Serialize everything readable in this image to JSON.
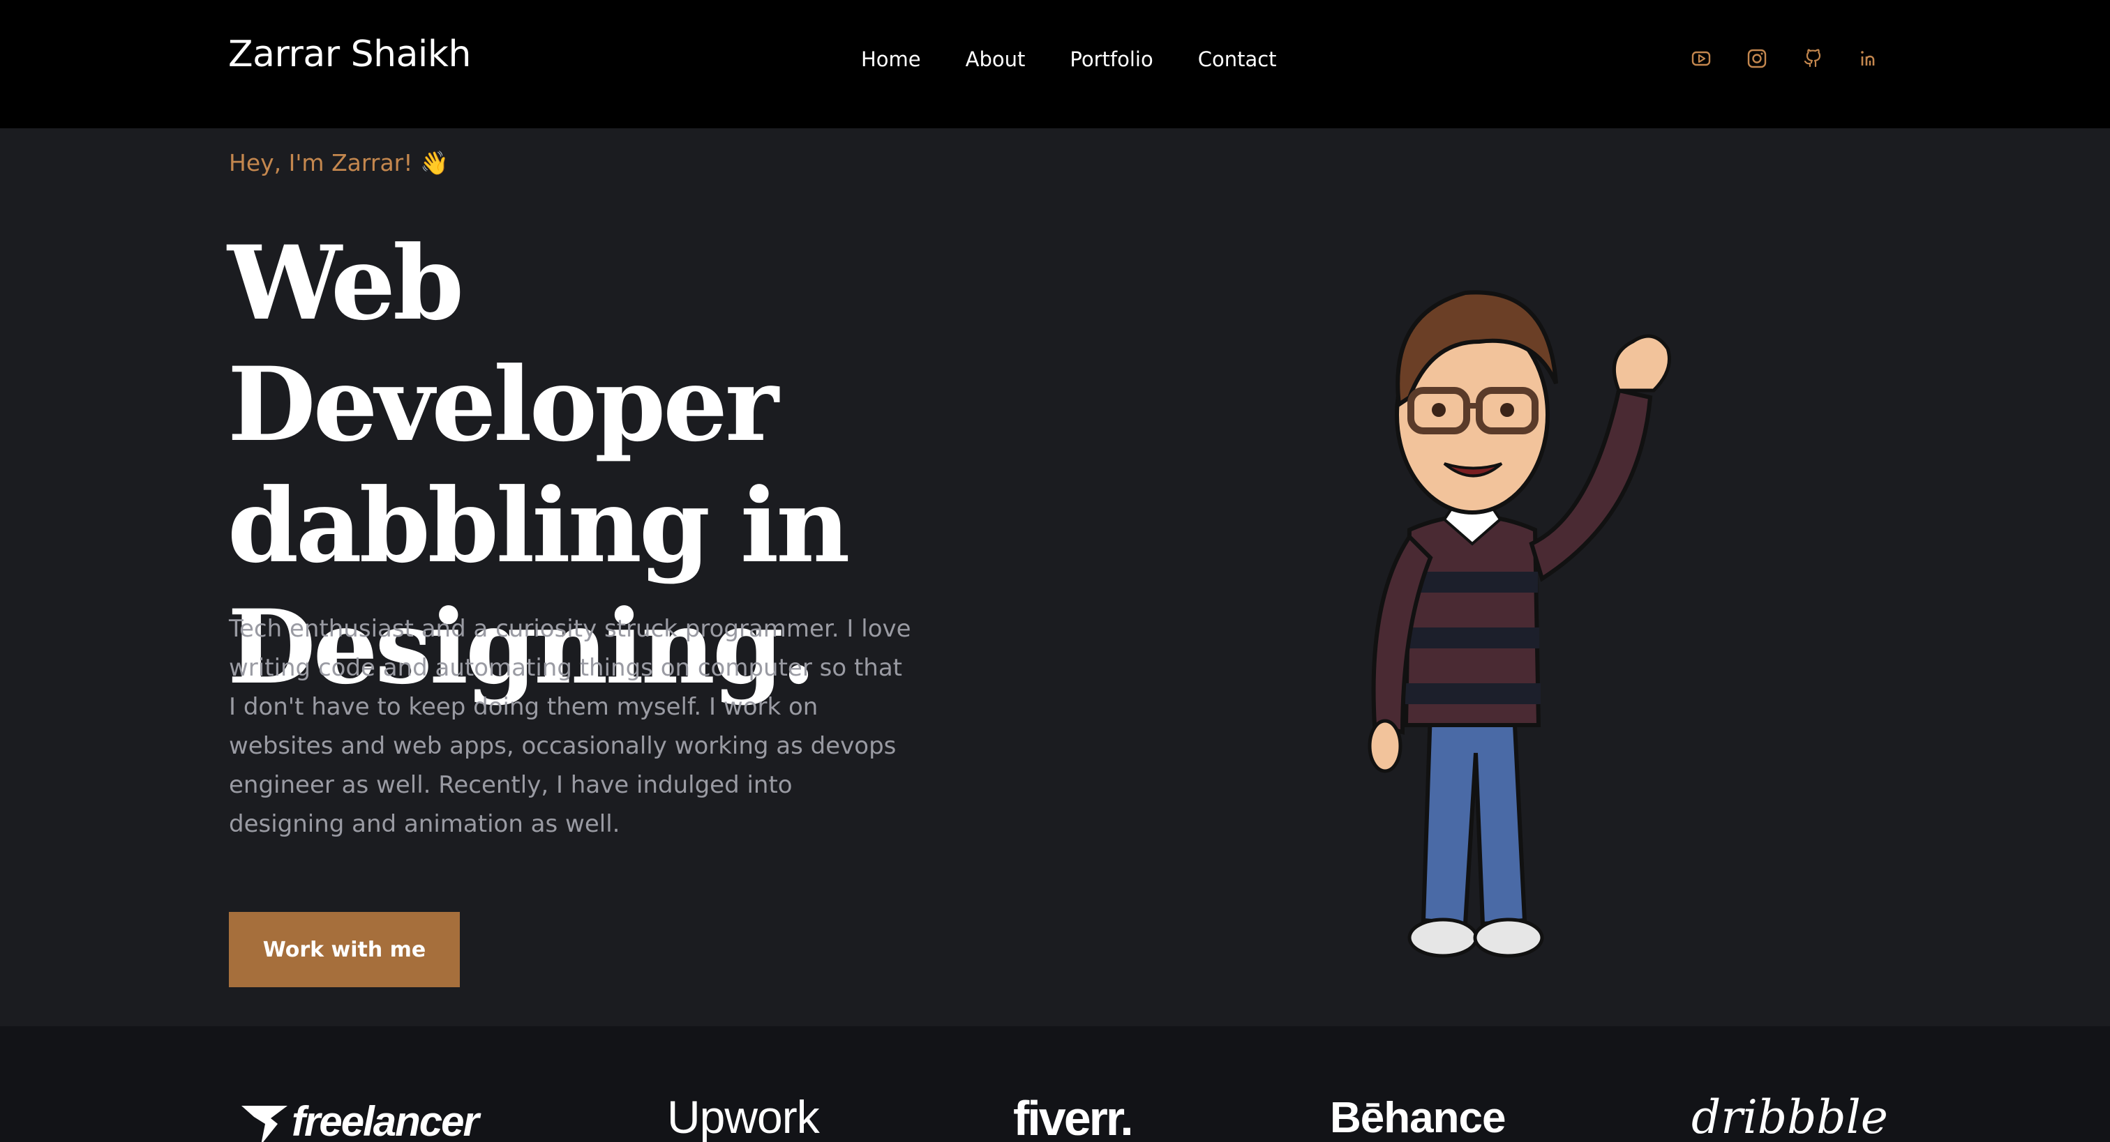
{
  "header": {
    "brand": "Zarrar Shaikh",
    "nav": [
      {
        "label": "Home"
      },
      {
        "label": "About"
      },
      {
        "label": "Portfolio"
      },
      {
        "label": "Contact"
      }
    ],
    "socials": [
      {
        "icon": "youtube-icon"
      },
      {
        "icon": "instagram-icon"
      },
      {
        "icon": "github-icon"
      },
      {
        "icon": "linkedin-icon"
      }
    ],
    "accent_color": "#c4874e"
  },
  "hero": {
    "greeting": "Hey, I'm Zarrar! 👋",
    "title_lines": [
      "Web Developer",
      "dabbling in",
      "Designing."
    ],
    "description": "Tech enthusiast and a curiosity struck programmer. I love writing code and automating things on computer so that I don't have to keep doing them myself. I work on websites and web apps, occasionally working as devops engineer as well. Recently, I have indulged into designing and animation as well.",
    "cta_label": "Work with me",
    "cta_color": "#a66f3c"
  },
  "logos": {
    "items": [
      {
        "label": "freelancer"
      },
      {
        "label": "Upwork"
      },
      {
        "label": "fiverr."
      },
      {
        "label": "Bēhance"
      },
      {
        "label": "dribbble"
      }
    ]
  }
}
